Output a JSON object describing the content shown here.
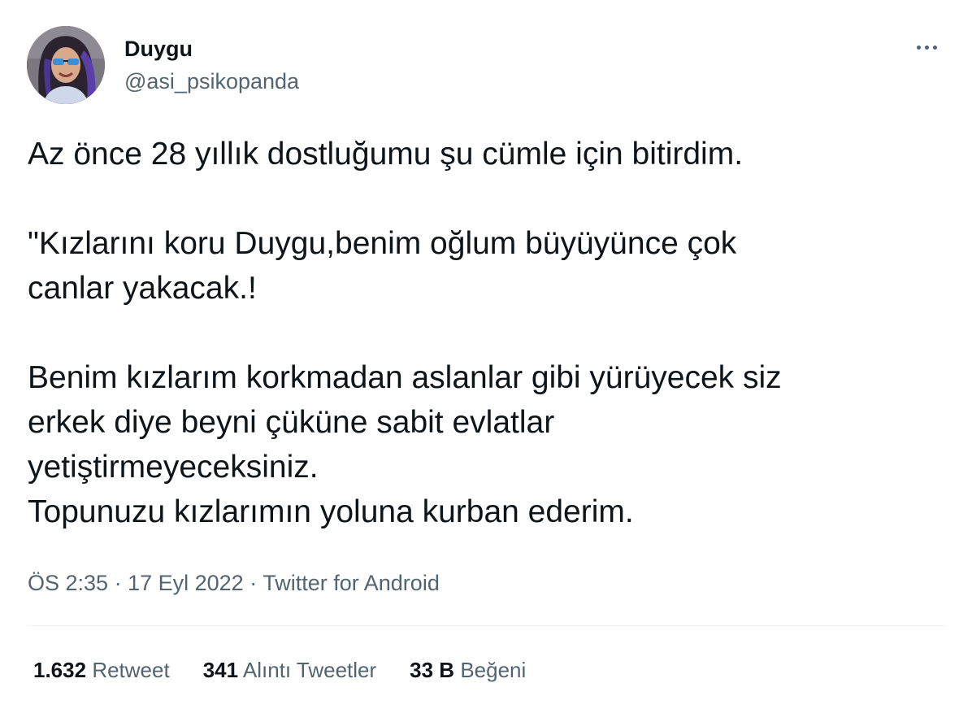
{
  "author": {
    "name": "Duygu",
    "handle": "@asi_psikopanda",
    "avatar_icon": "profile-photo"
  },
  "menu": {
    "icon": "more-options-icon"
  },
  "tweet": {
    "paragraphs": [
      [
        "Az önce 28 yıllık dostluğumu şu cümle için bitirdim."
      ],
      [
        "\"Kızlarını koru Duygu,benim oğlum büyüyünce çok",
        "canlar yakacak.!"
      ],
      [
        "Benim kızlarım korkmadan aslanlar gibi yürüyecek siz",
        "erkek diye beyni çüküne sabit evlatlar",
        "yetiştirmeyeceksiniz.",
        "Topunuzu kızlarımın yoluna kurban ederim."
      ]
    ]
  },
  "meta": {
    "time": "ÖS 2:35",
    "separator": "·",
    "date": "17 Eyl 2022",
    "source": "Twitter for Android"
  },
  "stats": {
    "retweets": {
      "count": "1.632",
      "label": "Retweet"
    },
    "quotes": {
      "count": "341",
      "label": "Alıntı Tweetler"
    },
    "likes": {
      "count": "33 B",
      "label": "Beğeni"
    }
  },
  "colors": {
    "text_primary": "#0f1419",
    "text_secondary": "#536471",
    "divider": "#eff3f4",
    "background": "#ffffff"
  }
}
